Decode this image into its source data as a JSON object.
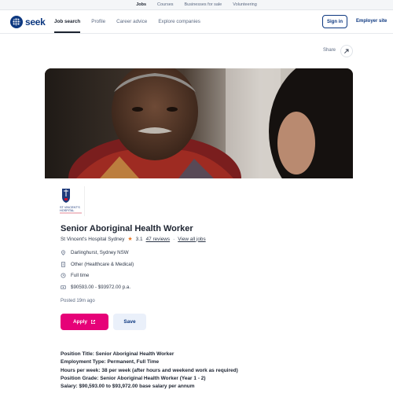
{
  "topbar": {
    "links": [
      "Jobs",
      "Courses",
      "Businesses for sale",
      "Volunteering"
    ]
  },
  "header": {
    "logo": "seek",
    "nav": [
      "Job search",
      "Profile",
      "Career advice",
      "Explore companies"
    ],
    "signin": "Sign in",
    "employer": "Employer site"
  },
  "share_label": "Share",
  "company_logo_text": "ST VINCENT'S HOSPITAL",
  "job": {
    "title": "Senior Aboriginal Health Worker",
    "company": "St Vincent's Hospital Sydney",
    "rating": "3.1",
    "reviews": "47 reviews",
    "view_all": "View all jobs",
    "location": "Darlinghurst, Sydney NSW",
    "classification": "Other (Healthcare & Medical)",
    "work_type": "Full time",
    "salary": "$90593.00 - $93972.00 p.a.",
    "posted": "Posted 19m ago"
  },
  "actions": {
    "apply": "Apply",
    "save": "Save"
  },
  "description": {
    "lines": [
      "Position Title: Senior Aboriginal Health Worker",
      "Employment Type: Permanent, Full Time",
      "Hours per week: 38 per week (after hours and weekend work as required)",
      "Position Grade: Senior Aboriginal Health Worker (Year 1 - 2)",
      "Salary: $90,593.00 to $93,972.00 base salary per annum"
    ]
  },
  "colors": {
    "brand": "#0d3880",
    "apply": "#e60278",
    "star": "#e87722"
  },
  "icons": [
    "share-icon",
    "location-icon",
    "classification-icon",
    "clock-icon",
    "salary-icon",
    "external-link-icon",
    "star-icon"
  ]
}
